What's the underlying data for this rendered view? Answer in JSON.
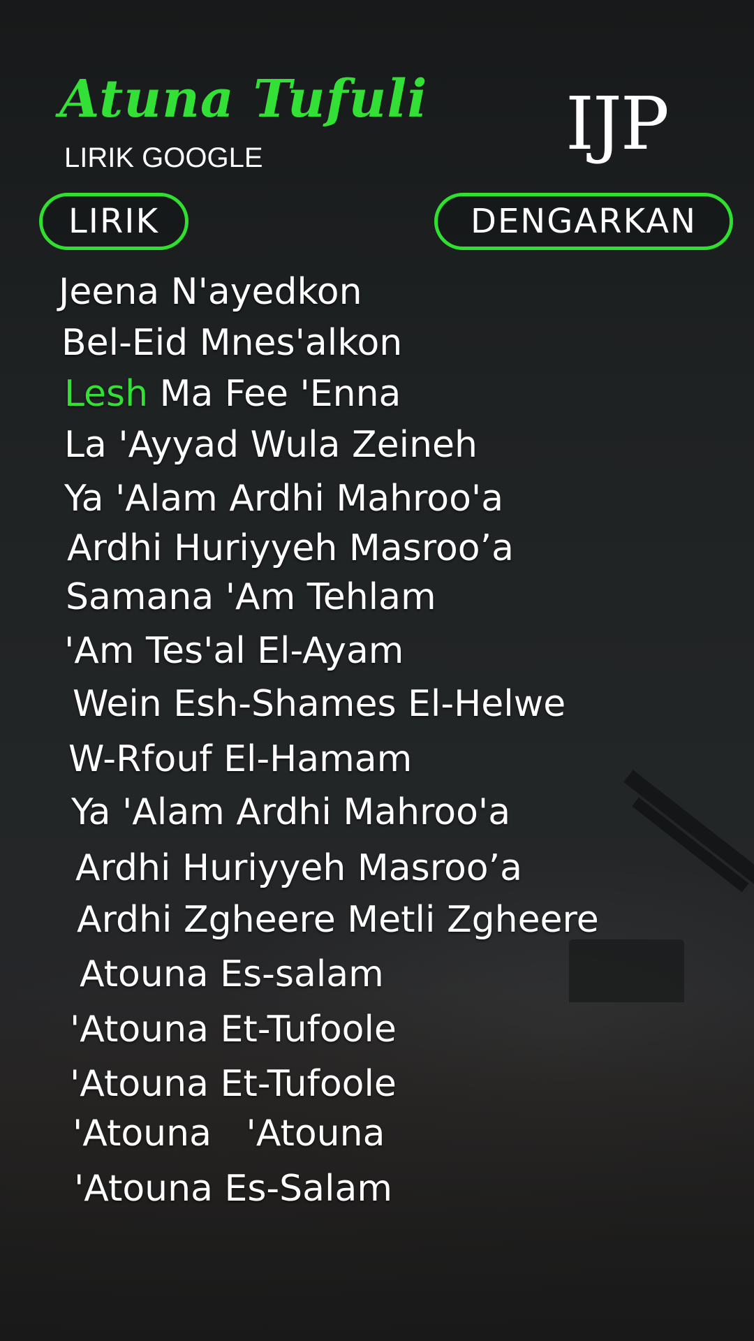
{
  "header": {
    "title": "Atuna Tufuli",
    "subtitle": "LIRIK GOOGLE",
    "logo_text": "IJP"
  },
  "buttons": {
    "lyrics_label": "LIRIK",
    "listen_label": "DENGARKAN"
  },
  "colors": {
    "accent": "#33e035",
    "text": "#ffffff",
    "background": "#1f2223"
  },
  "lyrics": {
    "line_1": "Jeena N'ayedkon",
    "line_2": "Bel-Eid Mnes'alkon",
    "line_3_highlight": "Lesh",
    "line_3_rest": " Ma Fee 'Enna",
    "line_4": "La 'Ayyad Wula Zeineh",
    "line_5": "Ya 'Alam Ardhi Mahroo'a",
    "line_6": "Ardhi Huriyyeh Masroo’a",
    "line_7": "Samana 'Am Tehlam",
    "line_8": "'Am Tes'al El-Ayam",
    "line_9": "Wein Esh-Shames El-Helwe",
    "line_10": "W-Rfouf El-Hamam",
    "line_11": "Ya 'Alam Ardhi Mahroo'a",
    "line_12": "Ardhi Huriyyeh Masroo’a",
    "line_13": "Ardhi Zgheere Metli Zgheere",
    "line_14": "Atouna Es-salam",
    "line_15": "'Atouna Et-Tufoole",
    "line_16": "'Atouna Et-Tufoole",
    "line_17": "'Atouna   'Atouna",
    "line_18": "'Atouna Es-Salam"
  }
}
